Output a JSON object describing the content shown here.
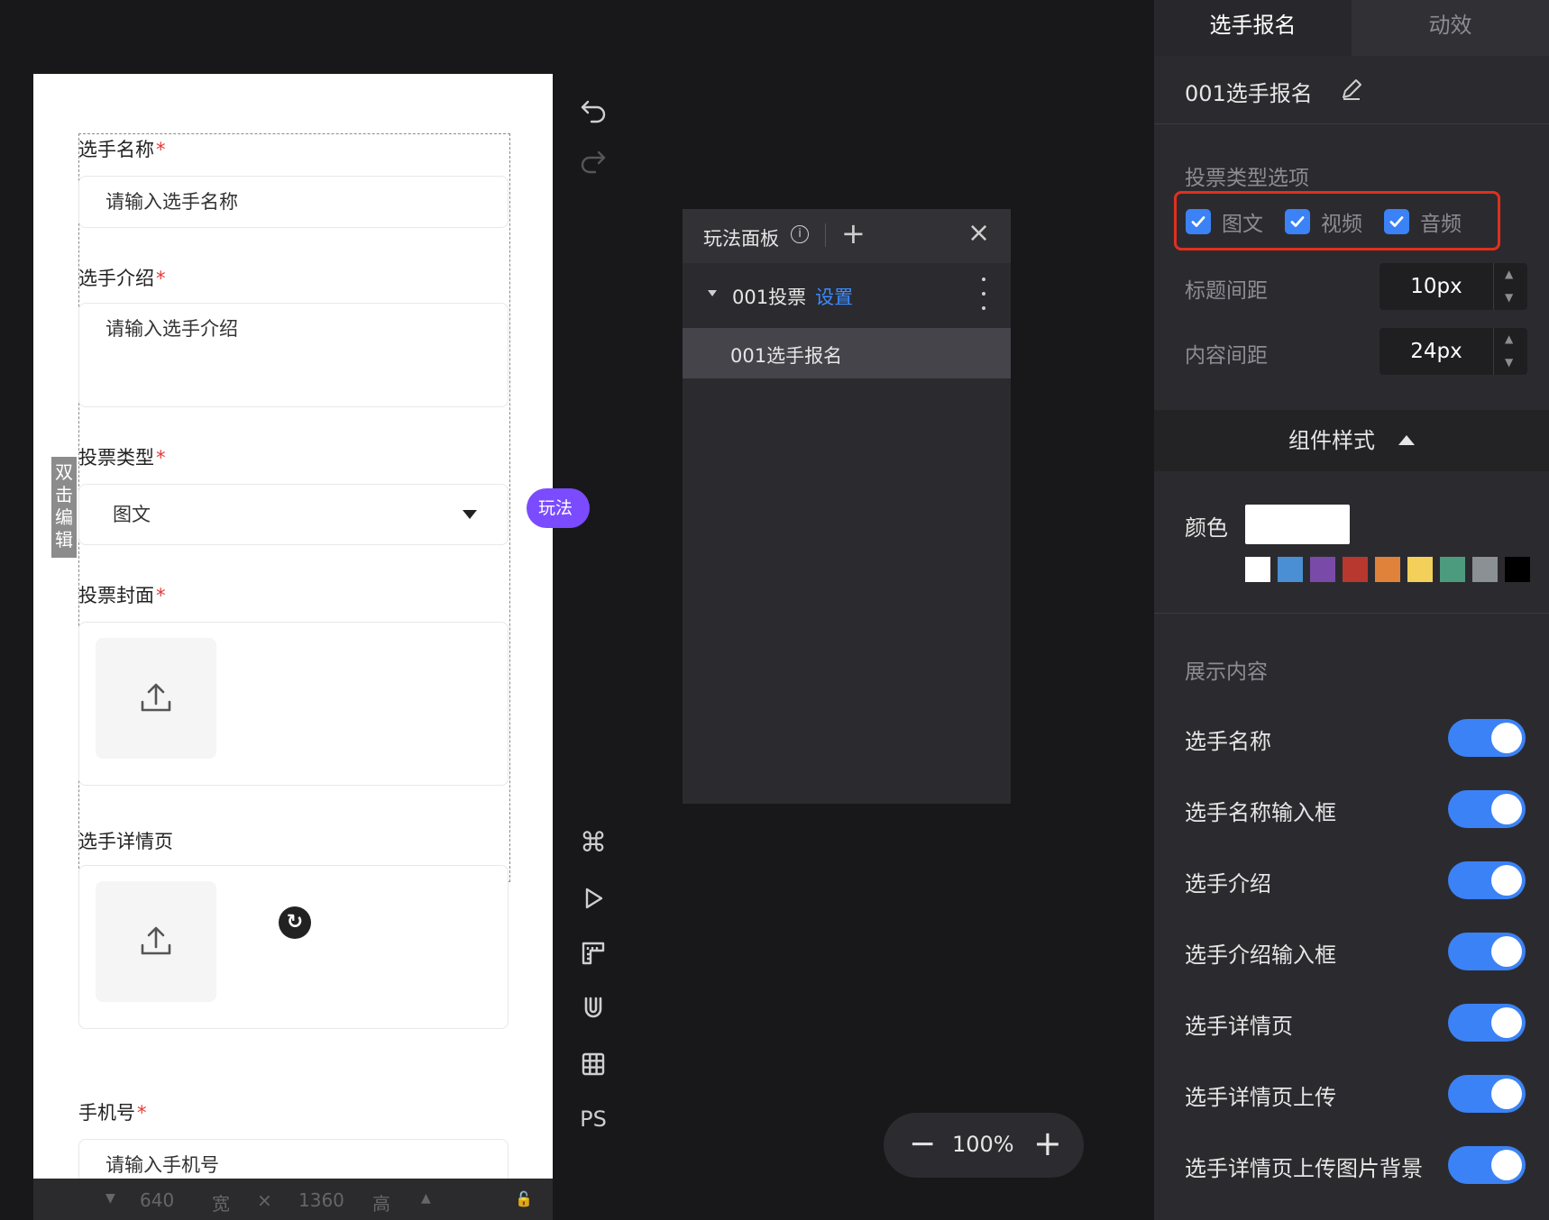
{
  "canvas": {
    "fields": {
      "player_name": {
        "label": "选手名称",
        "required": "*",
        "placeholder": "请输入选手名称"
      },
      "player_intro": {
        "label": "选手介绍",
        "required": "*",
        "placeholder": "请输入选手介绍"
      },
      "vote_type": {
        "label": "投票类型",
        "required": "*",
        "value": "图文"
      },
      "vote_cover": {
        "label": "投票封面",
        "required": "*"
      },
      "player_detail": {
        "label": "选手详情页"
      },
      "phone": {
        "label": "手机号",
        "required": "*",
        "placeholder": "请输入手机号"
      }
    },
    "side_tag": "双击编辑",
    "play_tag": "玩法",
    "footer": {
      "width": "640",
      "width_unit": "宽",
      "times": "×",
      "height": "1360",
      "height_unit": "高"
    }
  },
  "toolbar": {
    "ps_label": "PS"
  },
  "play_panel": {
    "title": "玩法面板",
    "info_icon": "i",
    "add_icon": "+",
    "close_icon": "×",
    "vote_item": "001投票",
    "settings_link": "设置",
    "child_item": "001选手报名"
  },
  "zoom": {
    "minus": "−",
    "value": "100%",
    "plus": "+"
  },
  "properties": {
    "tabs": {
      "active": "选手报名",
      "inactive": "动效"
    },
    "component_name": "001选手报名",
    "vote_type_section": "投票类型选项",
    "vote_options": [
      "图文",
      "视频",
      "音频"
    ],
    "title_spacing": {
      "label": "标题间距",
      "value": "10px"
    },
    "content_spacing": {
      "label": "内容间距",
      "value": "24px"
    },
    "style_header": "组件样式",
    "color_label": "颜色",
    "colors": [
      "#ffffff",
      "#4a8fd4",
      "#7a4aa8",
      "#b8372e",
      "#e0823a",
      "#f3d05a",
      "#4d9b7e",
      "#8a9093",
      "#000000"
    ],
    "display_section": "展示内容",
    "toggles": [
      "选手名称",
      "选手名称输入框",
      "选手介绍",
      "选手介绍输入框",
      "选手详情页",
      "选手详情页上传",
      "选手详情页上传图片背景"
    ],
    "accent_color": "#3b82f6"
  }
}
